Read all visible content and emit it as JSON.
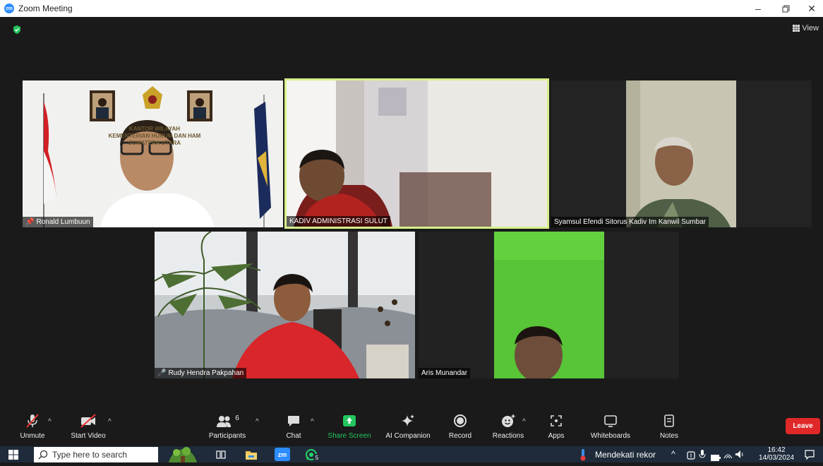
{
  "window": {
    "app_icon": "zm",
    "title": "Zoom Meeting",
    "controls": [
      "minimize-icon",
      "restore-icon",
      "close-icon"
    ]
  },
  "meeting": {
    "view_label": "View",
    "participants": [
      {
        "name": "Ronald Lumbuun",
        "pinned": true
      },
      {
        "name": "KADIV ADMINISTRASI SULUT",
        "active_speaker": true
      },
      {
        "name": "Syamsul Efendi Sitorus Kadiv Im Kanwil Sumbar"
      },
      {
        "name": "Rudy Hendra Pakpahan",
        "muted": true
      },
      {
        "name": "Aris Munandar"
      }
    ],
    "backdrop_text": [
      "KANTOR WILAYAH",
      "KEMENTERIAN HUKUM DAN HAM",
      "SUMATERA UTARA"
    ]
  },
  "toolbar": {
    "items": [
      {
        "label": "Unmute",
        "icon": "muted-mic-icon"
      },
      {
        "label": "Start Video",
        "icon": "video-off-icon"
      },
      {
        "label": "Participants",
        "icon": "participants-icon",
        "count": "6"
      },
      {
        "label": "Chat",
        "icon": "chat-icon"
      },
      {
        "label": "Share Screen",
        "icon": "share-screen-icon"
      },
      {
        "label": "AI Companion",
        "icon": "ai-companion-icon"
      },
      {
        "label": "Record",
        "icon": "record-icon"
      },
      {
        "label": "Reactions",
        "icon": "reactions-icon"
      },
      {
        "label": "Apps",
        "icon": "apps-icon"
      },
      {
        "label": "Whiteboards",
        "icon": "whiteboard-icon"
      },
      {
        "label": "Notes",
        "icon": "notes-icon"
      }
    ],
    "leave_label": "Leave",
    "colors": {
      "share": "#22c55e",
      "leave": "#e02828",
      "active_border": "#d7f08a"
    }
  },
  "taskbar": {
    "search_placeholder": "Type here to search",
    "weather_text": "Mendekati rekor",
    "whatsapp_badge": "5",
    "time": "16:42",
    "date": "14/03/2024"
  }
}
